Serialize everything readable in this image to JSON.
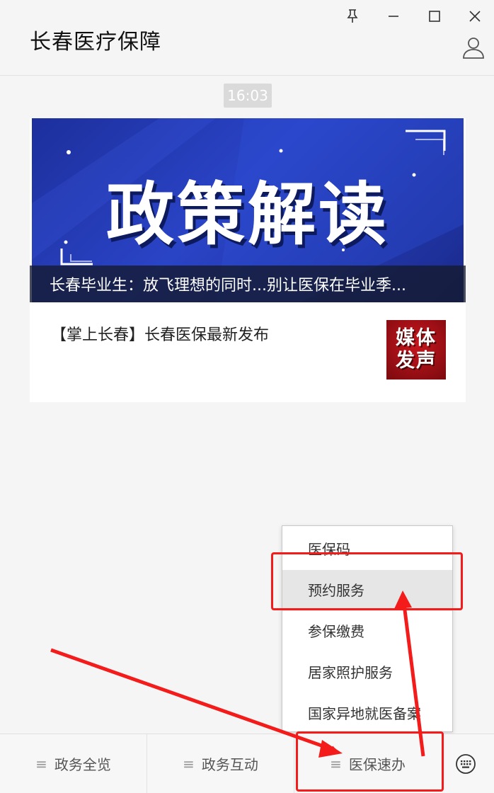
{
  "window": {
    "title": "长春医疗保障",
    "pin_icon": "pin-icon",
    "minimize_icon": "minimize-icon",
    "maximize_icon": "maximize-icon",
    "close_icon": "close-icon",
    "user_icon": "user-icon"
  },
  "chat": {
    "timestamp": "16:03",
    "card": {
      "banner_text": "政策解读",
      "headline": "长春毕业生：放飞理想的同时...别让医保在毕业季...",
      "article_title": "【掌上长春】长春医保最新发布",
      "thumb_line1": "媒体",
      "thumb_line2": "发声"
    }
  },
  "menu": {
    "items": [
      {
        "label": "医保码"
      },
      {
        "label": "预约服务"
      },
      {
        "label": "参保缴费"
      },
      {
        "label": "居家照护服务"
      },
      {
        "label": "国家异地就医备案"
      }
    ],
    "highlighted_index": 1
  },
  "bottom_bar": {
    "tabs": [
      {
        "label": "政务全览"
      },
      {
        "label": "政务互动"
      },
      {
        "label": "医保速办"
      }
    ],
    "menu_icon": "hamburger-icon",
    "keyboard_icon": "keyboard-icon"
  },
  "annotations": {
    "color": "#f41b1b"
  }
}
